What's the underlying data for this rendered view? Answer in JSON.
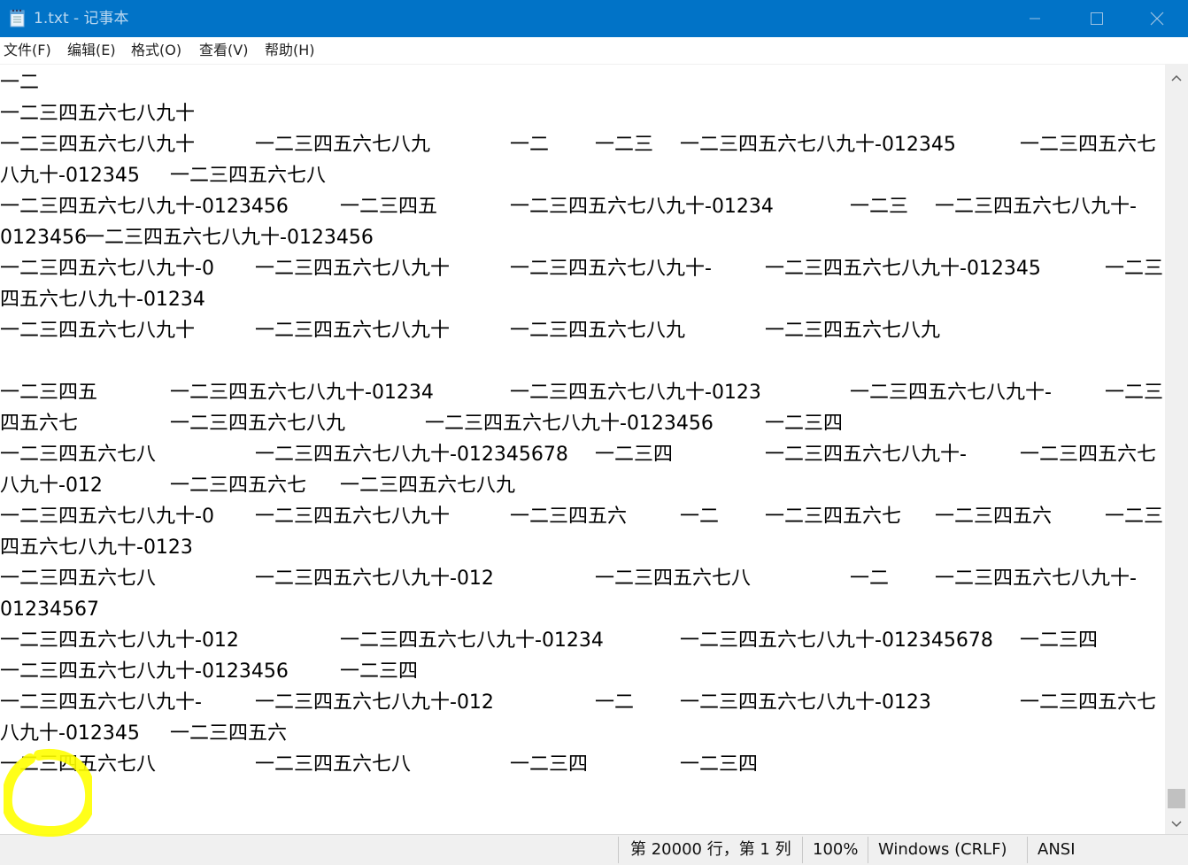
{
  "window": {
    "title": "1.txt - 记事本",
    "minimize_icon": "minimize-icon",
    "maximize_icon": "maximize-icon",
    "close_icon": "close-icon",
    "accent": "#0173c7"
  },
  "menu": {
    "items": [
      {
        "label": "文件(F)"
      },
      {
        "label": "编辑(E)"
      },
      {
        "label": "格式(O)"
      },
      {
        "label": "查看(V)"
      },
      {
        "label": "帮助(H)"
      }
    ]
  },
  "editor": {
    "lines": [
      [
        "一二"
      ],
      [
        "一二三四五六七八九十"
      ],
      [
        "一二三四五六七八九十",
        "一二三四五六七八九",
        "一二",
        "一二三",
        "一二三四五六七八九十-012345",
        "一二三四五六七"
      ],
      [
        "八九十-012345",
        "一二三四五六七八"
      ],
      [
        "一二三四五六七八九十-0123456",
        "一二三四五",
        "一二三四五六七八九十-01234",
        "一二三",
        "一二三四五六七八九十-"
      ],
      [
        "0123456",
        "一二三四五六七八九十-0123456"
      ],
      [
        "一二三四五六七八九十-0",
        "一二三四五六七八九十",
        "一二三四五六七八九十-",
        "一二三四五六七八九十-012345",
        "一二三"
      ],
      [
        "四五六七八九十-01234"
      ],
      [
        "一二三四五六七八九十",
        "一二三四五六七八九十",
        "一二三四五六七八九",
        "一二三四五六七八九"
      ],
      [],
      [
        "一二三四五",
        "一二三四五六七八九十-01234",
        "一二三四五六七八九十-0123",
        "一二三四五六七八九十-",
        "一二三"
      ],
      [
        "四五六七",
        "一二三四五六七八九",
        "一二三四五六七八九十-0123456",
        "一二三四"
      ],
      [
        "一二三四五六七八",
        "一二三四五六七八九十-012345678",
        "一二三四",
        "一二三四五六七八九十-",
        "一二三四五六七"
      ],
      [
        "八九十-012",
        "一二三四五六七",
        "一二三四五六七八九"
      ],
      [
        "一二三四五六七八九十-0",
        "一二三四五六七八九十",
        "一二三四五六",
        "一二",
        "一二三四五六七",
        "一二三四五六",
        "一二三"
      ],
      [
        "四五六七八九十-0123"
      ],
      [
        "一二三四五六七八",
        "一二三四五六七八九十-012",
        "一二三四五六七八",
        "一二",
        "一二三四五六七八九十-"
      ],
      [
        "01234567"
      ],
      [
        "一二三四五六七八九十-012",
        "一二三四五六七八九十-01234",
        "一二三四五六七八九十-012345678",
        "一二三四"
      ],
      [
        "一二三四五六七八九十-0123456",
        "一二三四"
      ],
      [
        "一二三四五六七八九十-",
        "一二三四五六七八九十-012",
        "一二",
        "一二三四五六七八九十-0123",
        "一二三四五六七"
      ],
      [
        "八九十-012345",
        "一二三四五六"
      ],
      [
        "一二三四五六七八",
        "一二三四五六七八",
        "一二三四",
        "一二三四"
      ]
    ]
  },
  "scrollbar": {
    "up_icon": "chevron-up-icon",
    "down_icon": "chevron-down-icon"
  },
  "status": {
    "position": "第 20000 行，第 1 列",
    "zoom": "100%",
    "line_ending": "Windows (CRLF)",
    "encoding": "ANSI"
  },
  "annotation": {
    "color": "#ffff00"
  }
}
